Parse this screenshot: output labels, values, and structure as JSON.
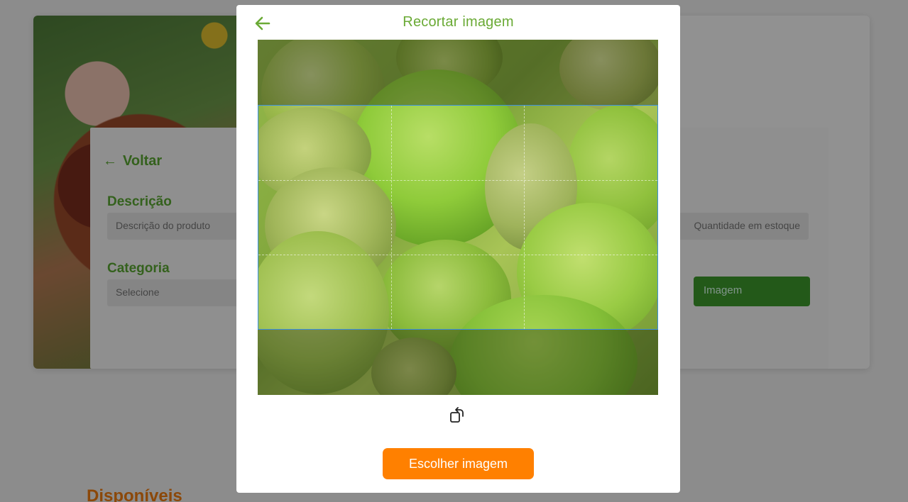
{
  "background": {
    "back_label": "Voltar",
    "description_label": "Descrição",
    "description_placeholder": "Descrição do produto",
    "category_label": "Categoria",
    "category_value": "Selecione",
    "stock_placeholder": "Quantidade em estoque",
    "image_button_label": "Imagem",
    "available_label": "Disponíveis"
  },
  "modal": {
    "title": "Recortar imagem",
    "back_icon": "arrow-left-icon",
    "rotate_icon": "rotate-icon",
    "choose_button_label": "Escolher imagem"
  },
  "colors": {
    "title_green": "#6aaa35",
    "button_orange": "#ff8000",
    "crop_border": "#3b8fe0"
  }
}
